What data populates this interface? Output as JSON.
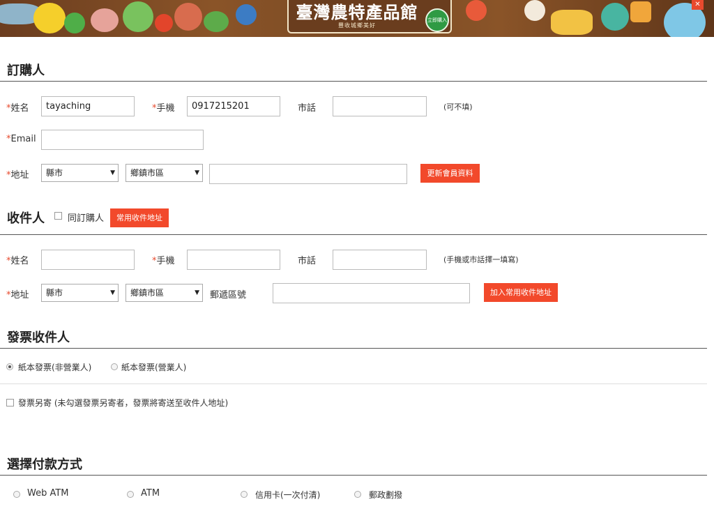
{
  "banner": {
    "title": "臺灣農特產品館",
    "subtitle": "豐收城鄉美好",
    "buy_label": "立即購入",
    "close_label": "✕"
  },
  "buyer": {
    "section_title": "訂購人",
    "name_label": "姓名",
    "name_value": "tayaching",
    "mobile_label": "手機",
    "mobile_value": "0917215201",
    "phone_label": "市話",
    "phone_value": "",
    "phone_note": "(可不填)",
    "email_label": "Email",
    "email_value": "",
    "address_label": "地址",
    "city_select": "縣市",
    "district_select": "鄉鎮市區",
    "address_value": "",
    "update_button": "更新會員資料",
    "required_mark": "*"
  },
  "receiver": {
    "section_title": "收件人",
    "same_as_buyer_label": "同訂購人",
    "common_address_button": "常用收件地址",
    "name_label": "姓名",
    "mobile_label": "手機",
    "phone_label": "市話",
    "phone_note": "(手機或市話擇一填寫)",
    "address_label": "地址",
    "city_select": "縣市",
    "district_select": "鄉鎮市區",
    "zip_label": "郵遞區號",
    "add_address_button": "加入常用收件地址"
  },
  "invoice": {
    "section_title": "發票收件人",
    "option_personal": "紙本發票(非營業人)",
    "option_business": "紙本發票(營業人)",
    "send_separately_label": "發票另寄 (未勾選發票另寄者，發票將寄送至收件人地址)"
  },
  "payment": {
    "section_title": "選擇付款方式",
    "options": [
      "Web ATM",
      "ATM",
      "信用卡(一次付清)",
      "郵政劃撥"
    ]
  },
  "colors": {
    "accent": "#f2492b",
    "required": "#e84a2e",
    "rule": "#555555"
  }
}
